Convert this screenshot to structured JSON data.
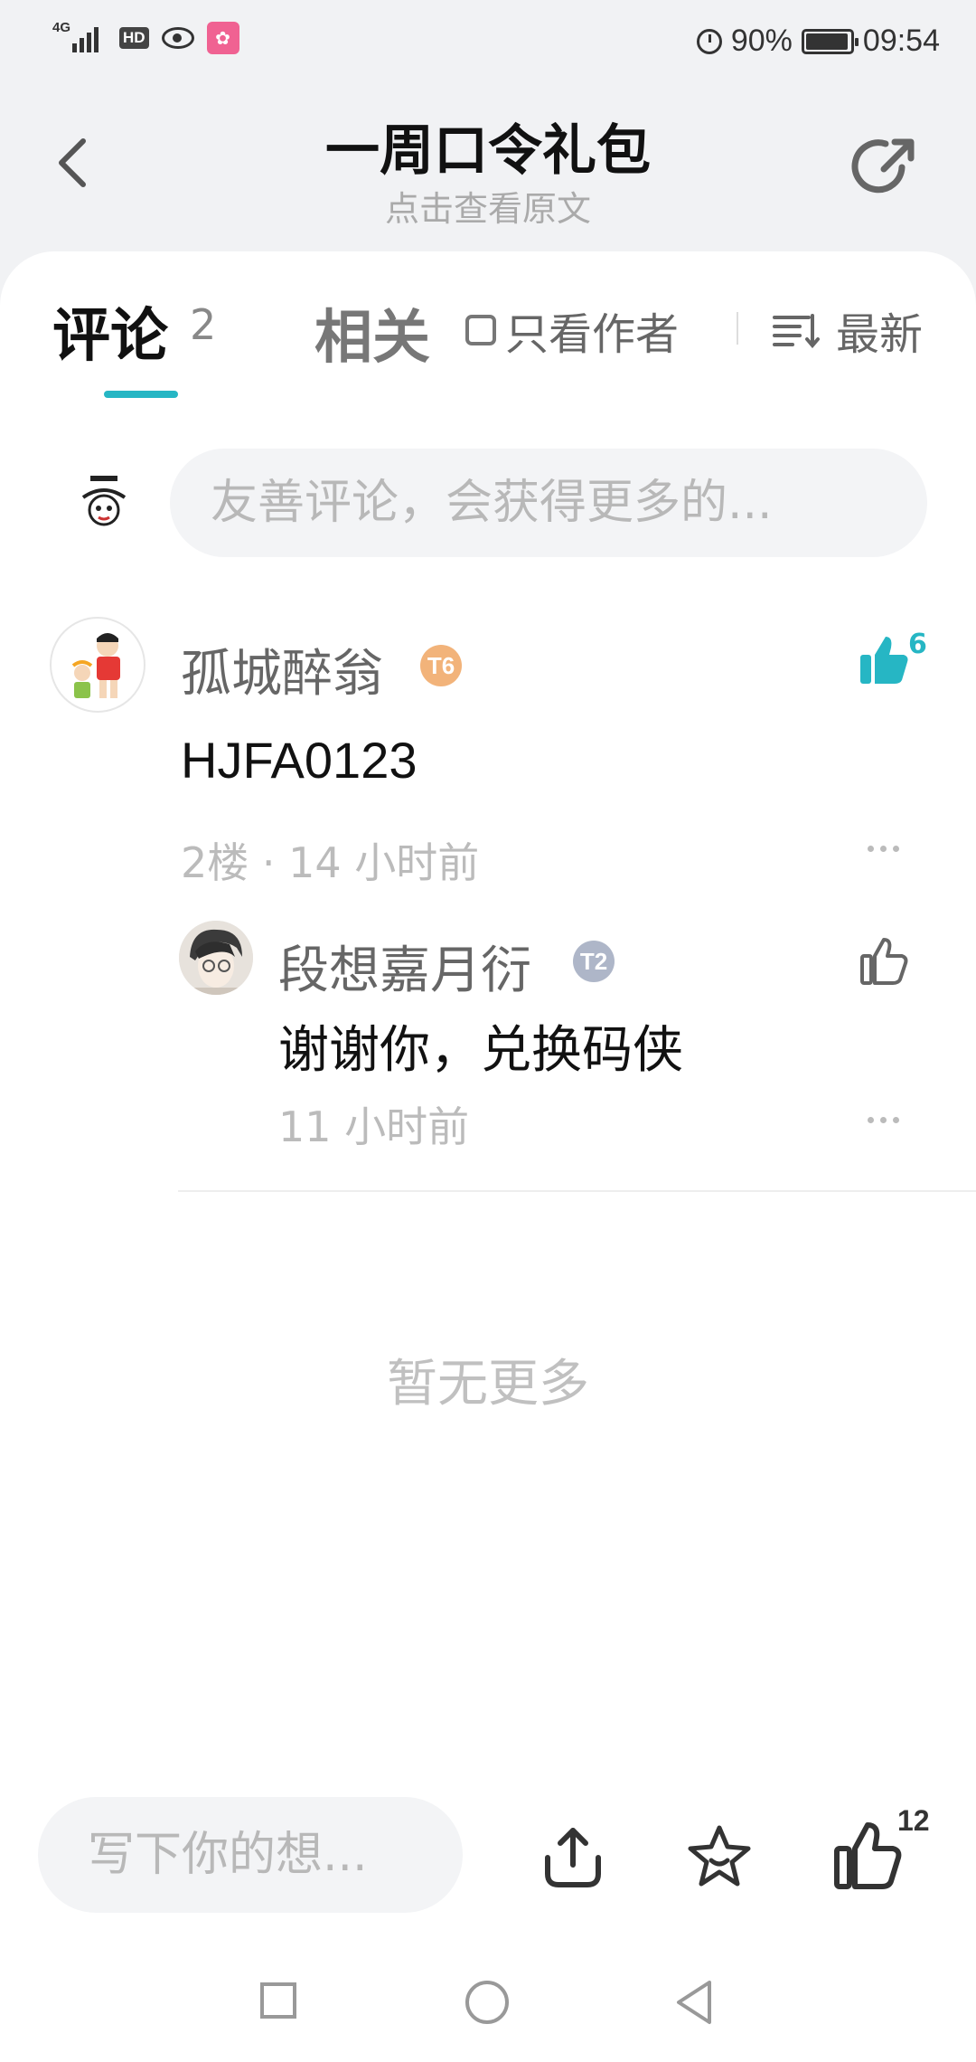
{
  "status_bar": {
    "network": "4G",
    "hd": "HD",
    "battery": "90%",
    "time": "09:54"
  },
  "header": {
    "title": "一周口令礼包",
    "subtitle": "点击查看原文"
  },
  "tabs": {
    "comments_label": "评论",
    "comments_count": "2",
    "related_label": "相关",
    "author_only_label": "只看作者",
    "sort_label": "最新"
  },
  "comment_input": {
    "placeholder": "友善评论，会获得更多的..."
  },
  "comments": [
    {
      "username": "孤城醉翁",
      "level": "T6",
      "likes": "6",
      "content": "HJFA0123",
      "meta": "2楼 · 14 小时前",
      "replies": [
        {
          "username": "段想嘉月衍",
          "level": "T2",
          "content": "谢谢你，兑换码侠",
          "meta": "11 小时前"
        }
      ]
    }
  ],
  "no_more": "暂无更多",
  "bottom_bar": {
    "write_placeholder": "写下你的想...",
    "like_count": "12"
  },
  "colors": {
    "accent": "#26b6c4",
    "level6": "#f2b37a",
    "level2": "#aeb6c8"
  }
}
